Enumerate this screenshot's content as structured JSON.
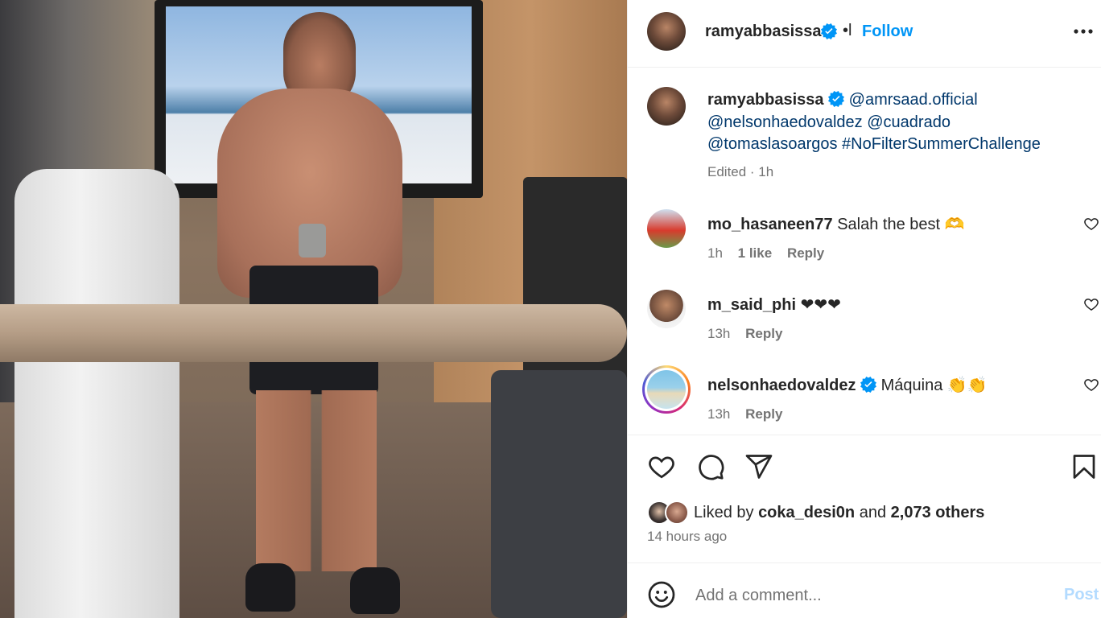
{
  "post": {
    "author": "ramyabbasissa",
    "follow_separator": "•l",
    "follow_label": "Follow",
    "more_label": "···"
  },
  "caption": {
    "author": "ramyabbasissa",
    "mentions": [
      "@amrsaad.official",
      "@nelsonhaedovaldez",
      "@cuadrado",
      "@tomaslasoargos",
      "#NoFilterSummerChallenge"
    ],
    "meta": "Edited · 1h"
  },
  "comments": [
    {
      "user": "mo_hasaneen77",
      "text": "Salah the best 🫶",
      "time": "1h",
      "likes": "1 like",
      "reply": "Reply",
      "verified": false
    },
    {
      "user": "m_said_phi",
      "text": "❤❤❤",
      "time": "13h",
      "reply": "Reply",
      "verified": false
    },
    {
      "user": "nelsonhaedovaldez",
      "text": "Máquina 👏👏",
      "time": "13h",
      "reply": "Reply",
      "verified": true
    }
  ],
  "liked_by": {
    "prefix": "Liked by",
    "user": "coka_desi0n",
    "conj": "and",
    "others": "2,073 others"
  },
  "posted_ago": "14 hours ago",
  "add_comment": {
    "placeholder": "Add a comment...",
    "post_label": "Post"
  },
  "colors": {
    "link": "#0095f6",
    "mention": "#00376b",
    "muted": "#737373",
    "verified": "#0095f6"
  },
  "icons": [
    "verified-icon",
    "more-icon",
    "heart-icon",
    "comment-icon",
    "share-icon",
    "bookmark-icon",
    "emoji-icon"
  ]
}
